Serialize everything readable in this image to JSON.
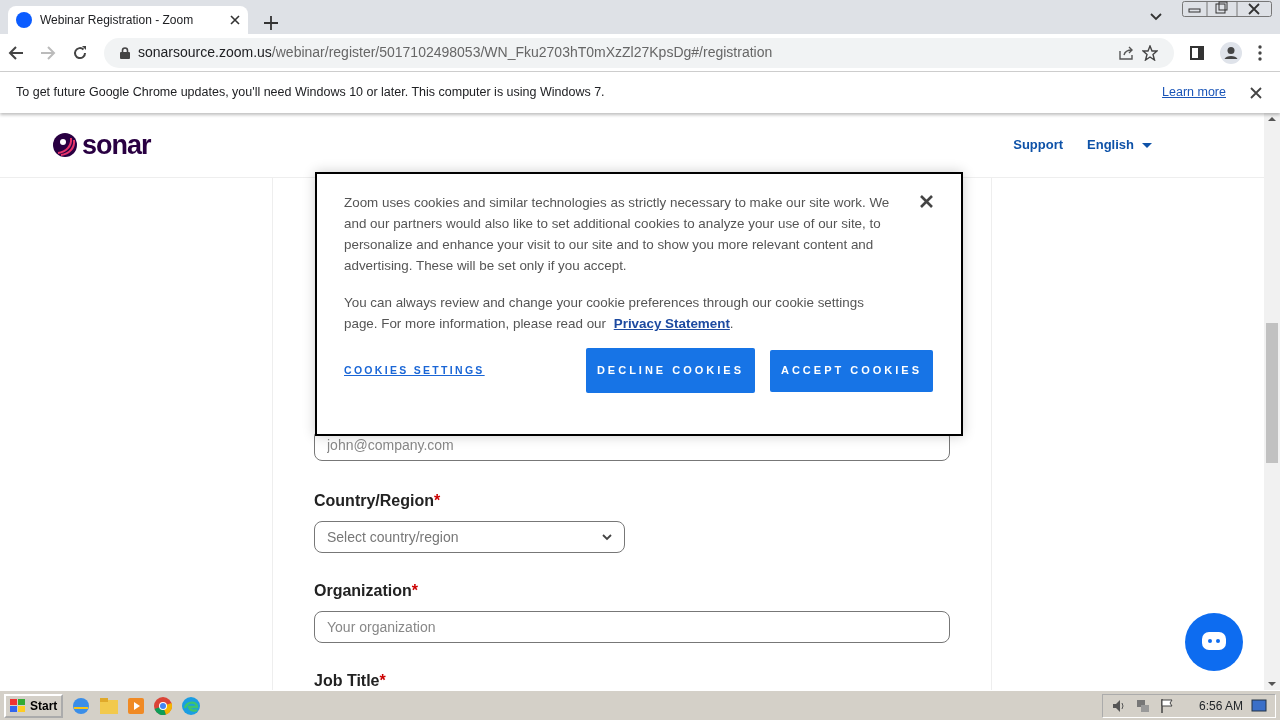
{
  "browser": {
    "tab_title": "Webinar Registration - Zoom",
    "url_host": "sonarsource.zoom.us",
    "url_path": "/webinar/register/5017102498053/WN_Fku2703hT0mXzZl27KpsDg#/registration"
  },
  "infobar": {
    "message": "To get future Google Chrome updates, you'll need Windows 10 or later. This computer is using Windows 7.",
    "link": "Learn more"
  },
  "header": {
    "logo": "sonar",
    "nav": [
      {
        "label": "Support",
        "dropdown": false
      },
      {
        "label": "English",
        "dropdown": true
      }
    ]
  },
  "form": {
    "fields": [
      {
        "kind": "text",
        "placeholder": "john@company.com"
      },
      {
        "kind": "select",
        "label": "Country/Region",
        "required_mark": "*",
        "placeholder": "Select country/region"
      },
      {
        "kind": "text",
        "label": "Organization",
        "required_mark": "*",
        "placeholder": "Your organization"
      },
      {
        "label": "Job Title",
        "required_mark": "*"
      }
    ]
  },
  "cookie_banner": {
    "text": "Zoom uses cookies and similar technologies as strictly necessary to make our site work. We and our partners would also like to set additional cookies to analyze your use of our site, to personalize and enhance your visit to our site and to show you more relevant content and advertising. These will be set only if you accept.",
    "text2": "You can always review and change your cookie preferences through our cookie settings page. For more information, please read our",
    "link": "Privacy Statement",
    "link_suffix": ".",
    "settings": "COOKIES SETTINGS",
    "buttons": [
      {
        "label": "DECLINE COOKIES"
      },
      {
        "label": "ACCEPT COOKIES"
      }
    ]
  },
  "taskbar": {
    "start": "Start",
    "clock": "6:56 AM"
  }
}
